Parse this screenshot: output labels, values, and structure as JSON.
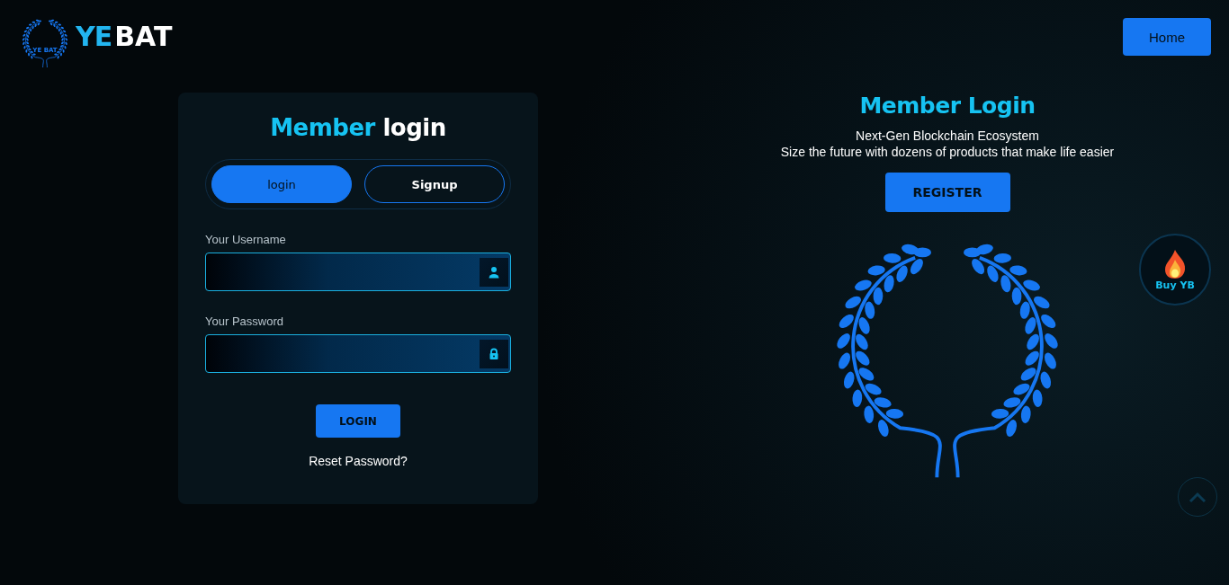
{
  "header": {
    "logo": {
      "emblem_text": "YE BAT",
      "wordmark_accent": "YE",
      "wordmark_rest": "BAT"
    },
    "nav_button": "Home"
  },
  "login_card": {
    "title_accent": "Member",
    "title_rest": "login",
    "tabs": [
      {
        "label": "login",
        "selected": true
      },
      {
        "label": "Signup",
        "selected": false
      }
    ],
    "fields": [
      {
        "label": "Your Username",
        "kind": "user"
      },
      {
        "label": "Your Password",
        "kind": "password"
      }
    ],
    "submit": "LOGIN",
    "reset_link": "Reset Password?"
  },
  "promo": {
    "title": "Member Login",
    "subtitle": "Next-Gen Blockchain Ecosystem",
    "tagline": "Size the future with dozens of products that make life easier",
    "button": "REGISTER"
  },
  "buy_badge": {
    "label": "Buy YB"
  }
}
